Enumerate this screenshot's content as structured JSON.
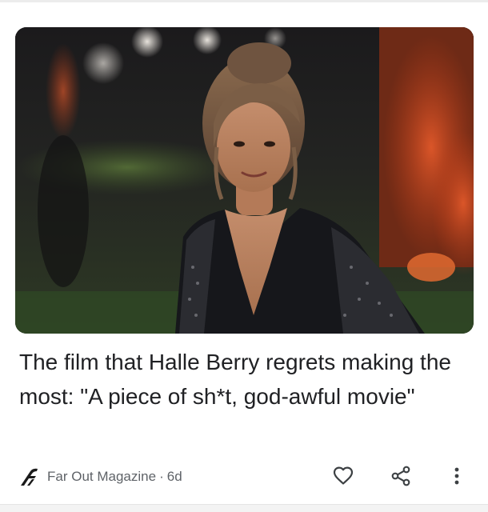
{
  "card": {
    "image": {
      "alt": "Halle Berry at an evening event"
    },
    "headline": "The film that Halle Berry regrets making the most: \"A piece of sh*t, god-awful movie\"",
    "source": {
      "name": "Far Out Magazine",
      "separator": "·",
      "age": "6d",
      "logo_icon": "far-out-logo"
    },
    "actions": {
      "like_icon": "heart-outline-icon",
      "share_icon": "share-icon",
      "more_icon": "more-vertical-icon"
    }
  },
  "colors": {
    "headline": "#202124",
    "meta": "#5f6368",
    "icon": "#3c4043"
  }
}
